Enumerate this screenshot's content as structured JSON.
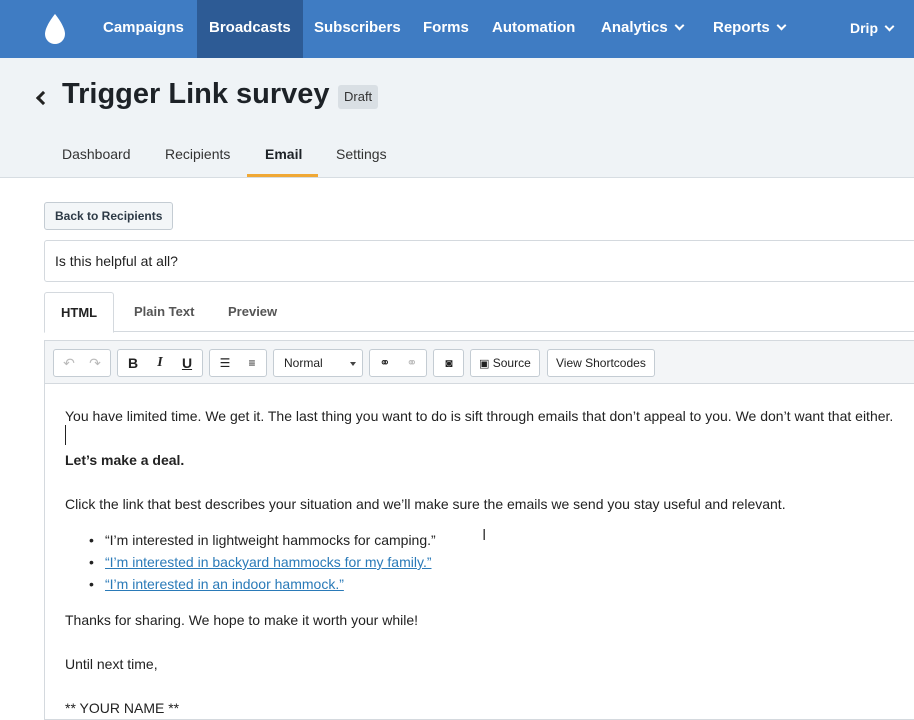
{
  "nav": {
    "items": [
      "Campaigns",
      "Broadcasts",
      "Subscribers",
      "Forms",
      "Automation",
      "Analytics",
      "Reports"
    ],
    "account": "Drip",
    "active": "Broadcasts",
    "brand_color": "#3f7cc3"
  },
  "header": {
    "title": "Trigger Link survey",
    "badge": "Draft",
    "tabs": [
      "Dashboard",
      "Recipients",
      "Email",
      "Settings"
    ],
    "active_tab": "Email"
  },
  "actions": {
    "back_label": "Back to Recipients"
  },
  "subject": {
    "value": "Is this helpful at all?"
  },
  "editor": {
    "tabs": [
      "HTML",
      "Plain Text",
      "Preview"
    ],
    "active_tab": "HTML",
    "toolbar": {
      "format_select": "Normal",
      "source_label": "Source",
      "shortcodes_label": "View Shortcodes",
      "bold": "B",
      "italic": "I",
      "underline": "U"
    },
    "content": {
      "p1": "You have limited time. We get it. The last thing you want to do is sift through emails that don’t appeal to you. We don’t want that either.",
      "p2": "Let’s make a deal.",
      "p3": "Click the link that best describes your situation and we’ll make sure the emails we send you stay useful and relevant.",
      "list": [
        "“I’m interested in lightweight hammocks for camping.”",
        "“I’m interested in backyard hammocks for my family.”",
        "“I’m interested in an indoor hammock.”"
      ],
      "p4": "Thanks for sharing. We hope to make it worth your while!",
      "p5": "Until next time,",
      "p6": "** YOUR NAME **"
    }
  }
}
